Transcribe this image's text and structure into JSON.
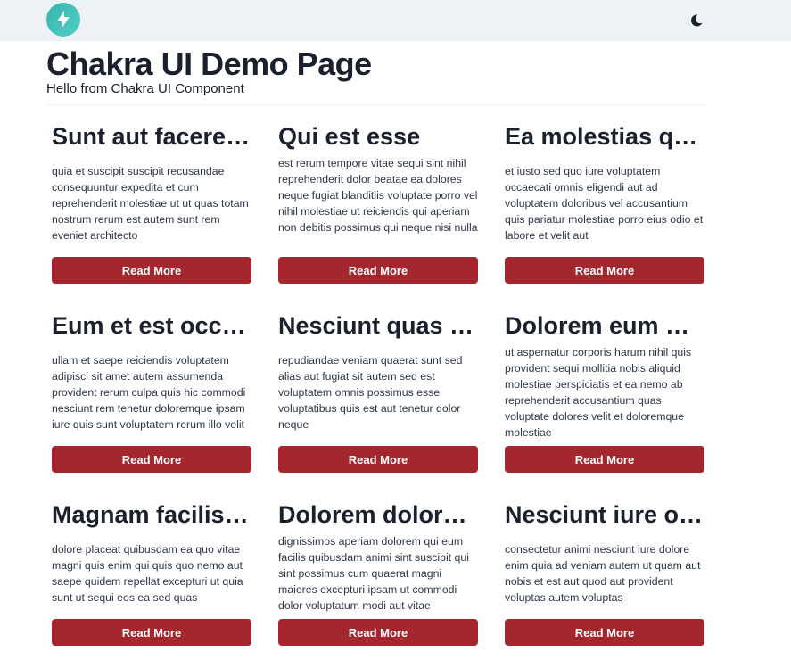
{
  "nav": {
    "logo_icon": "lightning-bolt-icon",
    "theme_icon": "moon-icon"
  },
  "header": {
    "title": "Chakra UI Demo Page",
    "subtitle": "Hello from Chakra UI Component"
  },
  "colors": {
    "navbar_bg": "#edf2f7",
    "button_bg": "#a5272e",
    "logo_teal": "#38b2ac"
  },
  "cards": [
    {
      "title": "Sunt aut facere …",
      "body": "quia et suscipit suscipit recusandae consequuntur expedita et cum reprehenderit molestiae ut ut quas totam nostrum rerum est autem sunt rem eveniet architecto",
      "button": "Read More"
    },
    {
      "title": "Qui est esse",
      "body": "est rerum tempore vitae sequi sint nihil reprehenderit dolor beatae ea dolores neque fugiat blanditiis voluptate porro vel nihil molestiae ut reiciendis qui aperiam non debitis possimus qui neque nisi nulla",
      "button": "Read More"
    },
    {
      "title": "Ea molestias qu…",
      "body": "et iusto sed quo iure voluptatem occaecati omnis eligendi aut ad voluptatem doloribus vel accusantium quis pariatur molestiae porro eius odio et labore et velit aut",
      "button": "Read More"
    },
    {
      "title": "Eum et est occa…",
      "body": "ullam et saepe reiciendis voluptatem adipisci sit amet autem assumenda provident rerum culpa quis hic commodi nesciunt rem tenetur doloremque ipsam iure quis sunt voluptatem rerum illo velit",
      "button": "Read More"
    },
    {
      "title": "Nesciunt quas o…",
      "body": "repudiandae veniam quaerat sunt sed alias aut fugiat sit autem sed est voluptatem omnis possimus esse voluptatibus quis est aut tenetur dolor neque",
      "button": "Read More"
    },
    {
      "title": "Dolorem eum m…",
      "body": "ut aspernatur corporis harum nihil quis provident sequi mollitia nobis aliquid molestiae perspiciatis et ea nemo ab reprehenderit accusantium quas voluptate dolores velit et doloremque molestiae",
      "button": "Read More"
    },
    {
      "title": "Magnam facilis …",
      "body": "dolore placeat quibusdam ea quo vitae magni quis enim qui quis quo nemo aut saepe quidem repellat excepturi ut quia sunt ut sequi eos ea sed quas",
      "button": "Read More"
    },
    {
      "title": "Dolorem dolore …",
      "body": "dignissimos aperiam dolorem qui eum facilis quibusdam animi sint suscipit qui sint possimus cum quaerat magni maiores excepturi ipsam ut commodi dolor voluptatum modi aut vitae",
      "button": "Read More"
    },
    {
      "title": "Nesciunt iure o…",
      "body": "consectetur animi nesciunt iure dolore enim quia ad veniam autem ut quam aut nobis et est aut quod aut provident voluptas autem voluptas",
      "button": "Read More"
    }
  ]
}
